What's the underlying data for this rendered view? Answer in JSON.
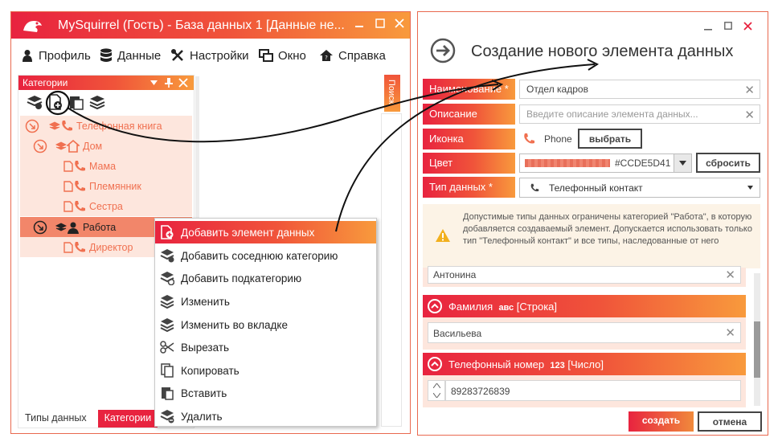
{
  "left_window": {
    "title": "MySquirrel (Гость) - База данных 1 [Данные не...",
    "menu": [
      "Профиль",
      "Данные",
      "Настройки",
      "Окно",
      "Справка"
    ],
    "categories_panel": {
      "title": "Категории",
      "tree": [
        {
          "label": "Телефонная книга"
        },
        {
          "label": "Дом"
        },
        {
          "label": "Мама"
        },
        {
          "label": "Племянник"
        },
        {
          "label": "Сестра"
        },
        {
          "label": "Работа"
        },
        {
          "label": "Директор"
        }
      ]
    },
    "search_tab": "Поиск",
    "bottom_tabs": [
      "Типы данных",
      "Категории"
    ],
    "context_menu": [
      "Добавить элемент данных",
      "Добавить соседнюю категорию",
      "Добавить подкатегорию",
      "Изменить",
      "Изменить во вкладке",
      "Вырезать",
      "Копировать",
      "Вставить",
      "Удалить"
    ]
  },
  "right_window": {
    "title": "Создание нового элемента данных",
    "fields": {
      "name_label": "Наименование *",
      "name_value": "Отдел кадров",
      "desc_label": "Описание",
      "desc_placeholder": "Введите описание элемента данных...",
      "icon_label": "Иконка",
      "icon_value": "Phone",
      "icon_button": "выбрать",
      "color_label": "Цвет",
      "color_value": "#CCDE5D41",
      "color_reset": "сбросить",
      "type_label": "Тип данных *",
      "type_value": "Телефонный контакт"
    },
    "info_text": "Допустимые типы данных ограничены категорией \"Работа\", в которую добавляется создаваемый элемент. Допускается использовать только тип \"Телефонный контакт\" и все типы, наследованные от него",
    "blocks": {
      "first_value": "Антонина",
      "surname_label": "Фамилия",
      "surname_type_tag": "авс",
      "surname_type": "[Строка]",
      "surname_value": "Васильева",
      "phone_label": "Телефонный номер",
      "phone_type_tag": "123",
      "phone_type": "[Число]",
      "phone_value": "89283726839"
    },
    "buttons": {
      "create": "создать",
      "cancel": "отмена"
    }
  },
  "colors": {
    "accent_red": "#e8233f",
    "accent_orange": "#f89a3c",
    "tree_text": "#f07050",
    "selected_row": "#f2866a"
  }
}
